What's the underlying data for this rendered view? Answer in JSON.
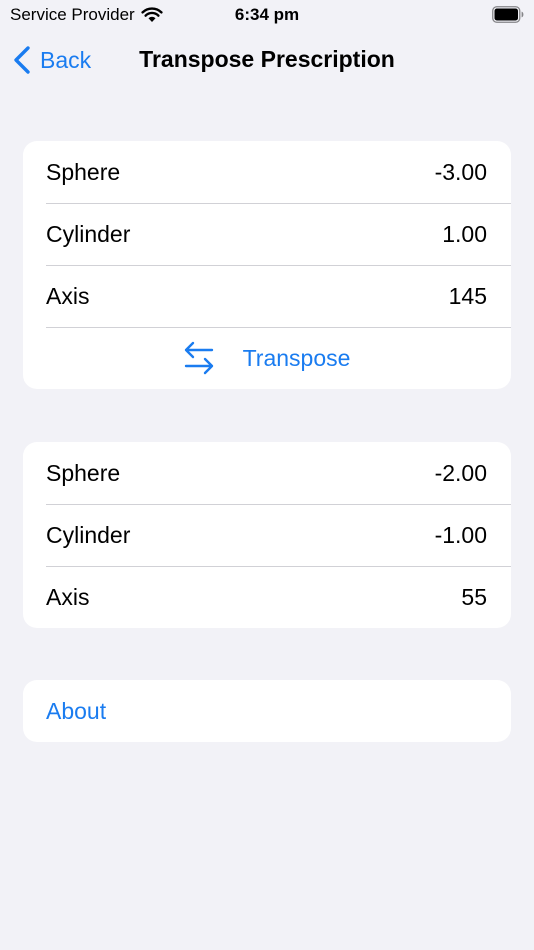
{
  "status_bar": {
    "carrier": "Service Provider",
    "time": "6:34 pm"
  },
  "nav": {
    "back_label": "Back",
    "title": "Transpose Prescription"
  },
  "input": {
    "rows": [
      {
        "label": "Sphere",
        "value": "-3.00"
      },
      {
        "label": "Cylinder",
        "value": "1.00"
      },
      {
        "label": "Axis",
        "value": "145"
      }
    ],
    "transpose_label": "Transpose"
  },
  "result": {
    "rows": [
      {
        "label": "Sphere",
        "value": "-2.00"
      },
      {
        "label": "Cylinder",
        "value": "-1.00"
      },
      {
        "label": "Axis",
        "value": "55"
      }
    ]
  },
  "about": {
    "label": "About"
  },
  "colors": {
    "accent": "#1a7cf0",
    "background": "#f2f2f7",
    "card": "#ffffff",
    "separator": "#d1d1d6"
  }
}
